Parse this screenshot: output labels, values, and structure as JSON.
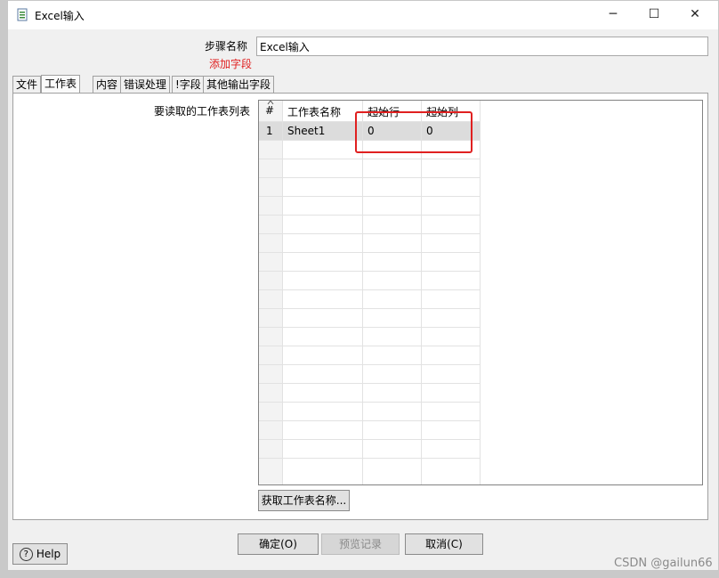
{
  "window": {
    "title": "Excel输入",
    "minimize_glyph": "─",
    "maximize_glyph": "☐",
    "close_glyph": "✕"
  },
  "form": {
    "step_name_label": "步骤名称",
    "step_name_value": "Excel输入",
    "add_field_link": "添加字段"
  },
  "tabs": [
    {
      "label": "文件"
    },
    {
      "label": "工作表"
    },
    {
      "label": "内容"
    },
    {
      "label": "错误处理"
    },
    {
      "label": "!字段"
    },
    {
      "label": "其他输出字段"
    }
  ],
  "active_tab": "工作表",
  "sheets_panel": {
    "label": "要读取的工作表列表",
    "columns": [
      "#",
      "工作表名称",
      "起始行",
      "起始列"
    ],
    "rows": [
      {
        "num": "1",
        "sheet": "Sheet1",
        "start_row": "0",
        "start_col": "0"
      }
    ],
    "get_sheets_button": "获取工作表名称..."
  },
  "buttons": {
    "ok": "确定(O)",
    "preview": "预览记录",
    "cancel": "取消(C)",
    "help": "Help"
  },
  "watermark": "CSDN @gailun66",
  "colors": {
    "highlight": "#e02020",
    "add_field": "#e02020"
  }
}
